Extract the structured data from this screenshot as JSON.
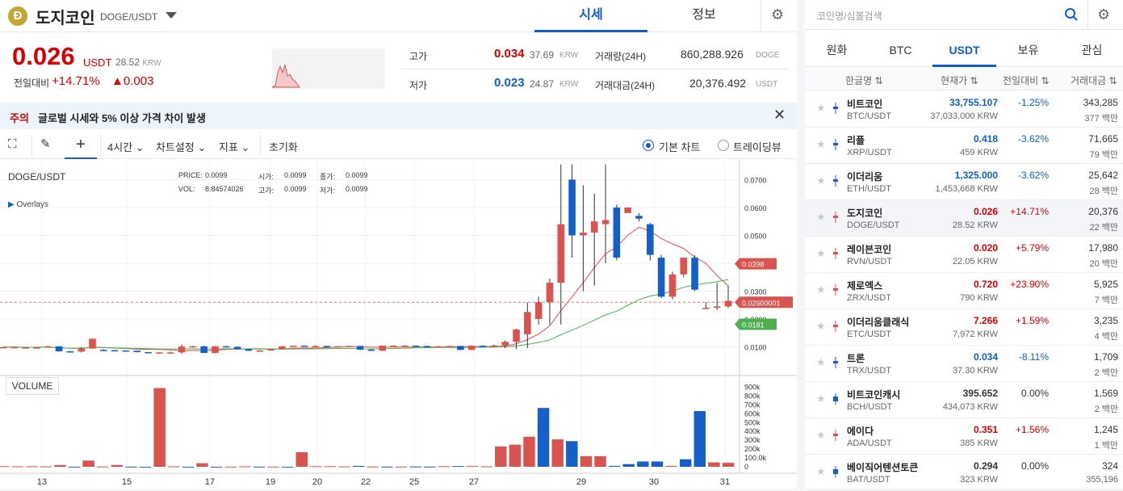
{
  "coin": {
    "logo": "Đ",
    "name": "도지코인",
    "pair": "DOGE/USDT"
  },
  "tabs": [
    {
      "label": "시세"
    },
    {
      "label": "정보"
    }
  ],
  "price": {
    "value": "0.026",
    "unit": "USDT",
    "krw": "28.52",
    "krw_unit": "KRW",
    "change_label": "전일대비",
    "change_pct": "+14.71%",
    "change_abs": "▲0.003"
  },
  "stats": {
    "high_label": "고가",
    "high": "0.034",
    "high_krw": "37.69",
    "high_krw_unit": "KRW",
    "low_label": "저가",
    "low": "0.023",
    "low_krw": "24.87",
    "low_krw_unit": "KRW",
    "volume_label": "거래량(24H)",
    "volume": "860,288.926",
    "volume_unit": "DOGE",
    "amount_label": "거래대금(24H)",
    "amount": "20,376.492",
    "amount_unit": "USDT"
  },
  "warning": {
    "tag": "주의",
    "text": "글로벌 시세와 5% 이상 가격 차이 발생"
  },
  "toolbar": {
    "interval": "4시간",
    "chart_settings": "차트설정",
    "indicators": "지표",
    "reset": "초기화",
    "basic_chart": "기본 차트",
    "tradingview": "트레이딩뷰"
  },
  "chart_info": {
    "pair": "DOGE/USDT",
    "overlays": "Overlays",
    "price_label": "PRICE:",
    "price": "0.0099",
    "vol_label": "VOL:",
    "vol": "8.84574026",
    "open_label": "시가:",
    "open": "0.0099",
    "close_label": "종가:",
    "close": "0.0099",
    "high_label": "고가:",
    "high": "0.0099",
    "low_label": "저가:",
    "low": "0.0099",
    "volume_title": "VOLUME"
  },
  "colors": {
    "up": "#d9534f",
    "down": "#1560c7",
    "ma_red": "#e05050",
    "ma_green": "#4caf50",
    "accent": "#115dcb"
  },
  "chart_data": {
    "type": "candlestick",
    "x_ticks": [
      "13",
      "15",
      "17",
      "19",
      "20",
      "22",
      "25",
      "27",
      "29",
      "30",
      "31"
    ],
    "y_ticks": [
      "0.0700",
      "0.0600",
      "0.0500",
      "0.0400",
      "0.0300",
      "0.0200",
      "0.0100"
    ],
    "ylim": [
      0.0,
      0.0765
    ],
    "price_tags": [
      {
        "value": "0.0398"
      },
      {
        "value": "0.02600001"
      },
      {
        "value": "0.0181"
      }
    ],
    "candles": [
      [
        0.0099,
        0.0099,
        0.0099,
        0.0099
      ],
      [
        0.0099,
        0.01,
        0.0099,
        0.0099
      ],
      [
        0.0097,
        0.0098,
        0.0097,
        0.0098
      ],
      [
        0.0098,
        0.0099,
        0.0097,
        0.0098
      ],
      [
        0.0099,
        0.0104,
        0.0097,
        0.0102
      ],
      [
        0.0102,
        0.0102,
        0.0082,
        0.0084
      ],
      [
        0.0084,
        0.0086,
        0.0081,
        0.0083
      ],
      [
        0.0083,
        0.0099,
        0.008,
        0.0094
      ],
      [
        0.0094,
        0.013,
        0.0093,
        0.0129
      ],
      [
        0.0089,
        0.0092,
        0.0087,
        0.0088
      ],
      [
        0.0088,
        0.0089,
        0.0085,
        0.0087
      ],
      [
        0.0087,
        0.0088,
        0.0084,
        0.0086
      ],
      [
        0.0086,
        0.0086,
        0.008,
        0.0081
      ],
      [
        0.0081,
        0.0082,
        0.008,
        0.008
      ],
      [
        0.008,
        0.0081,
        0.0079,
        0.008
      ],
      [
        0.008,
        0.0083,
        0.0079,
        0.008
      ],
      [
        0.008,
        0.0108,
        0.0075,
        0.0101
      ],
      [
        0.0101,
        0.0104,
        0.0098,
        0.0102
      ],
      [
        0.0102,
        0.0104,
        0.0078,
        0.0078
      ],
      [
        0.0078,
        0.0103,
        0.0077,
        0.0102
      ],
      [
        0.0102,
        0.0104,
        0.0099,
        0.01
      ],
      [
        0.01,
        0.0101,
        0.009,
        0.0092
      ],
      [
        0.0092,
        0.0093,
        0.0085,
        0.0086
      ],
      [
        0.0086,
        0.0089,
        0.0084,
        0.0087
      ],
      [
        0.0087,
        0.0093,
        0.0086,
        0.0092
      ],
      [
        0.0092,
        0.0103,
        0.009,
        0.0102
      ],
      [
        0.0102,
        0.0105,
        0.0101,
        0.0104
      ],
      [
        0.0104,
        0.0105,
        0.01,
        0.0102
      ],
      [
        0.0102,
        0.0106,
        0.0101,
        0.0103
      ],
      [
        0.0103,
        0.0104,
        0.0099,
        0.01
      ],
      [
        0.01,
        0.0103,
        0.0098,
        0.0102
      ],
      [
        0.0102,
        0.0104,
        0.0101,
        0.0103
      ],
      [
        0.0103,
        0.0104,
        0.0088,
        0.009
      ],
      [
        0.009,
        0.0093,
        0.0085,
        0.0086
      ],
      [
        0.0086,
        0.0105,
        0.0085,
        0.0104
      ],
      [
        0.0104,
        0.0106,
        0.0102,
        0.0104
      ],
      [
        0.0104,
        0.0106,
        0.0102,
        0.0104
      ],
      [
        0.0104,
        0.0105,
        0.0102,
        0.0103
      ],
      [
        0.0103,
        0.0104,
        0.01,
        0.0101
      ],
      [
        0.0101,
        0.0103,
        0.0099,
        0.0102
      ],
      [
        0.0102,
        0.0104,
        0.01,
        0.0103
      ],
      [
        0.0103,
        0.0104,
        0.0088,
        0.0089
      ],
      [
        0.0089,
        0.0105,
        0.0088,
        0.0104
      ],
      [
        0.0104,
        0.0106,
        0.0102,
        0.0103
      ],
      [
        0.0103,
        0.0108,
        0.01,
        0.0105
      ],
      [
        0.0105,
        0.0123,
        0.0095,
        0.0118
      ],
      [
        0.0118,
        0.0165,
        0.0092,
        0.0162
      ],
      [
        0.0145,
        0.026,
        0.0095,
        0.0225
      ],
      [
        0.02,
        0.028,
        0.018,
        0.026
      ],
      [
        0.026,
        0.0345,
        0.018,
        0.033
      ],
      [
        0.033,
        0.0755,
        0.018,
        0.054
      ],
      [
        0.07,
        0.0755,
        0.042,
        0.05
      ],
      [
        0.05,
        0.068,
        0.03,
        0.051
      ],
      [
        0.051,
        0.065,
        0.032,
        0.055
      ],
      [
        0.054,
        0.0755,
        0.04,
        0.0555
      ],
      [
        0.06,
        0.061,
        0.041,
        0.042
      ],
      [
        0.058,
        0.06,
        0.058,
        0.06
      ],
      [
        0.057,
        0.058,
        0.055,
        0.056
      ],
      [
        0.054,
        0.0545,
        0.041,
        0.043
      ],
      [
        0.042,
        0.043,
        0.0275,
        0.028
      ],
      [
        0.028,
        0.037,
        0.027,
        0.036
      ],
      [
        0.036,
        0.042,
        0.035,
        0.042
      ],
      [
        0.042,
        0.043,
        0.03,
        0.0305
      ],
      [
        0.024,
        0.026,
        0.0236,
        0.024
      ],
      [
        0.024,
        0.033,
        0.0232,
        0.0245
      ],
      [
        0.0245,
        0.032,
        0.024,
        0.0265
      ]
    ],
    "volume_ticks": [
      "900k",
      "800k",
      "700k",
      "600k",
      "500k",
      "400k",
      "300k",
      "200k",
      "100.0k",
      "0"
    ],
    "volumes": [
      [
        6,
        1
      ],
      [
        5,
        1
      ],
      [
        5,
        1
      ],
      [
        4,
        1
      ],
      [
        20,
        1
      ],
      [
        1,
        0
      ],
      [
        70,
        1
      ],
      [
        3,
        1
      ],
      [
        20,
        1
      ],
      [
        2,
        0
      ],
      [
        1,
        0
      ],
      [
        890,
        1
      ],
      [
        5,
        1
      ],
      [
        1,
        0
      ],
      [
        40,
        1
      ],
      [
        1,
        0
      ],
      [
        2,
        1
      ],
      [
        5,
        1
      ],
      [
        2,
        0
      ],
      [
        2,
        1
      ],
      [
        1,
        0
      ],
      [
        165,
        1
      ],
      [
        6,
        1
      ],
      [
        6,
        1
      ],
      [
        4,
        1
      ],
      [
        10,
        0
      ],
      [
        3,
        1
      ],
      [
        2,
        0
      ],
      [
        2,
        1
      ],
      [
        3,
        0
      ],
      [
        2,
        0
      ],
      [
        6,
        1
      ],
      [
        8,
        0
      ],
      [
        8,
        1
      ],
      [
        5,
        1
      ],
      [
        230,
        1
      ],
      [
        250,
        1
      ],
      [
        340,
        1
      ],
      [
        665,
        0
      ],
      [
        310,
        1
      ],
      [
        290,
        0
      ],
      [
        120,
        1
      ],
      [
        120,
        1
      ],
      [
        10,
        0
      ],
      [
        30,
        0
      ],
      [
        60,
        0
      ],
      [
        60,
        0
      ],
      [
        10,
        1
      ],
      [
        85,
        0
      ],
      [
        630,
        0
      ],
      [
        50,
        1
      ],
      [
        45,
        1
      ]
    ]
  },
  "right": {
    "search_placeholder": "코인명/심볼검색",
    "tabs": [
      {
        "label": "원화"
      },
      {
        "label": "BTC"
      },
      {
        "label": "USDT"
      },
      {
        "label": "보유"
      },
      {
        "label": "관심"
      }
    ],
    "headers": {
      "name": "한글명 ⇅",
      "price": "현재가 ⇅",
      "change": "전일대비 ⇅",
      "volume": "거래대금 ⇅"
    },
    "rows": [
      {
        "name": "비트코인",
        "pair": "BTC/USDT",
        "price": "33,755.107",
        "krw": "37,033,000 KRW",
        "change": "-1.25%",
        "vol": "343,285",
        "vol_unit": "377 백만",
        "dir": "dn"
      },
      {
        "name": "리플",
        "pair": "XRP/USDT",
        "price": "0.418",
        "krw": "459 KRW",
        "change": "-3.62%",
        "vol": "71,665",
        "vol_unit": "79 백만",
        "dir": "dn"
      },
      {
        "name": "이더리움",
        "pair": "ETH/USDT",
        "price": "1,325.000",
        "krw": "1,453,668 KRW",
        "change": "-3.62%",
        "vol": "25,642",
        "vol_unit": "28 백만",
        "dir": "dn"
      },
      {
        "name": "도지코인",
        "pair": "DOGE/USDT",
        "price": "0.026",
        "krw": "28.52 KRW",
        "change": "+14.71%",
        "vol": "20,376",
        "vol_unit": "22 백만",
        "dir": "up"
      },
      {
        "name": "레이븐코인",
        "pair": "RVN/USDT",
        "price": "0.020",
        "krw": "22.05 KRW",
        "change": "+5.79%",
        "vol": "17,980",
        "vol_unit": "20 백만",
        "dir": "up"
      },
      {
        "name": "제로엑스",
        "pair": "ZRX/USDT",
        "price": "0.720",
        "krw": "790 KRW",
        "change": "+23.90%",
        "vol": "5,925",
        "vol_unit": "7 백만",
        "dir": "up"
      },
      {
        "name": "이더리움클래식",
        "pair": "ETC/USDT",
        "price": "7.266",
        "krw": "7,972 KRW",
        "change": "+1.59%",
        "vol": "3,235",
        "vol_unit": "4 백만",
        "dir": "up"
      },
      {
        "name": "트론",
        "pair": "TRX/USDT",
        "price": "0.034",
        "krw": "37.30 KRW",
        "change": "-8.11%",
        "vol": "1,709",
        "vol_unit": "2 백만",
        "dir": "dn"
      },
      {
        "name": "비트코인캐시",
        "pair": "BCH/USDT",
        "price": "395.652",
        "krw": "434,073 KRW",
        "change": "0.00%",
        "vol": "1,569",
        "vol_unit": "2 백만",
        "dir": "eq"
      },
      {
        "name": "에이다",
        "pair": "ADA/USDT",
        "price": "0.351",
        "krw": "385 KRW",
        "change": "+1.56%",
        "vol": "1,245",
        "vol_unit": "1 백만",
        "dir": "up"
      },
      {
        "name": "베이직어텐션토큰",
        "pair": "BAT/USDT",
        "price": "0.294",
        "krw": "323 KRW",
        "change": "0.00%",
        "vol": "324",
        "vol_unit": "355,196",
        "dir": "eq"
      }
    ]
  }
}
